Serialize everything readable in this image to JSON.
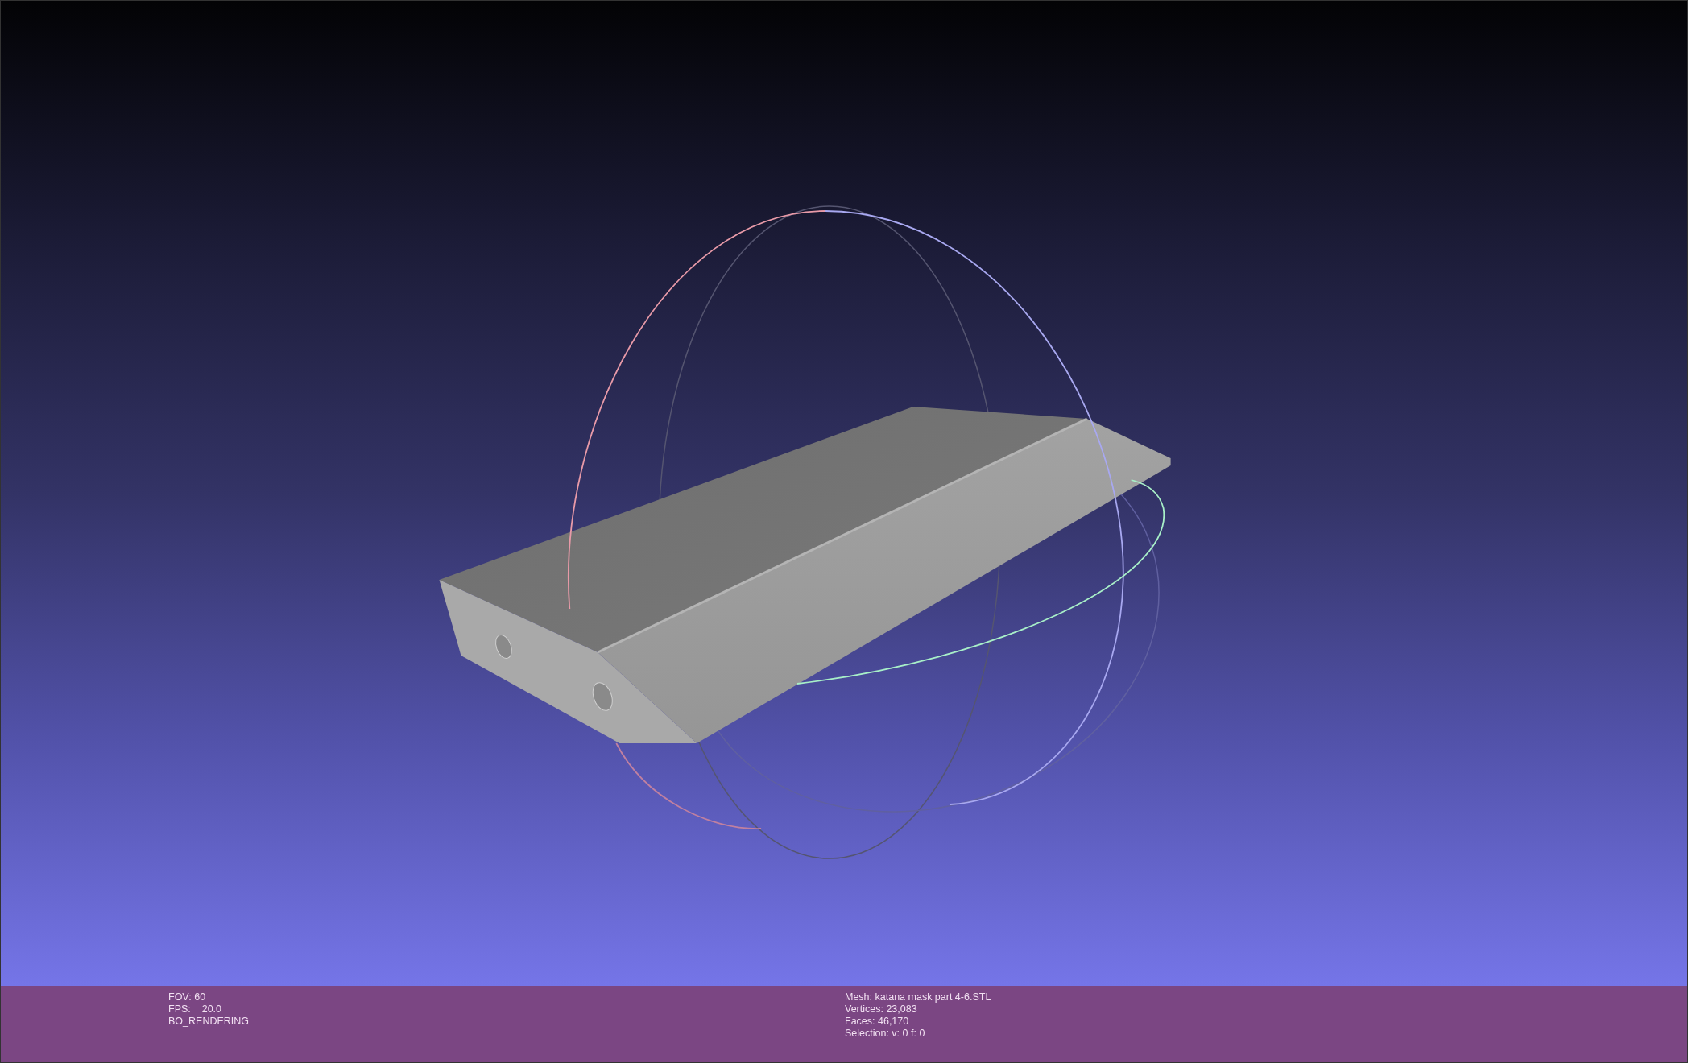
{
  "info_bar": {
    "left_lines": [
      "FOV: 60",
      "FPS:    20.0",
      "BO_RENDERING"
    ],
    "right_lines": [
      "Mesh: katana mask part 4-6.STL",
      "Vertices: 23,083",
      "Faces: 46,170",
      "Selection: v: 0 f: 0"
    ]
  }
}
